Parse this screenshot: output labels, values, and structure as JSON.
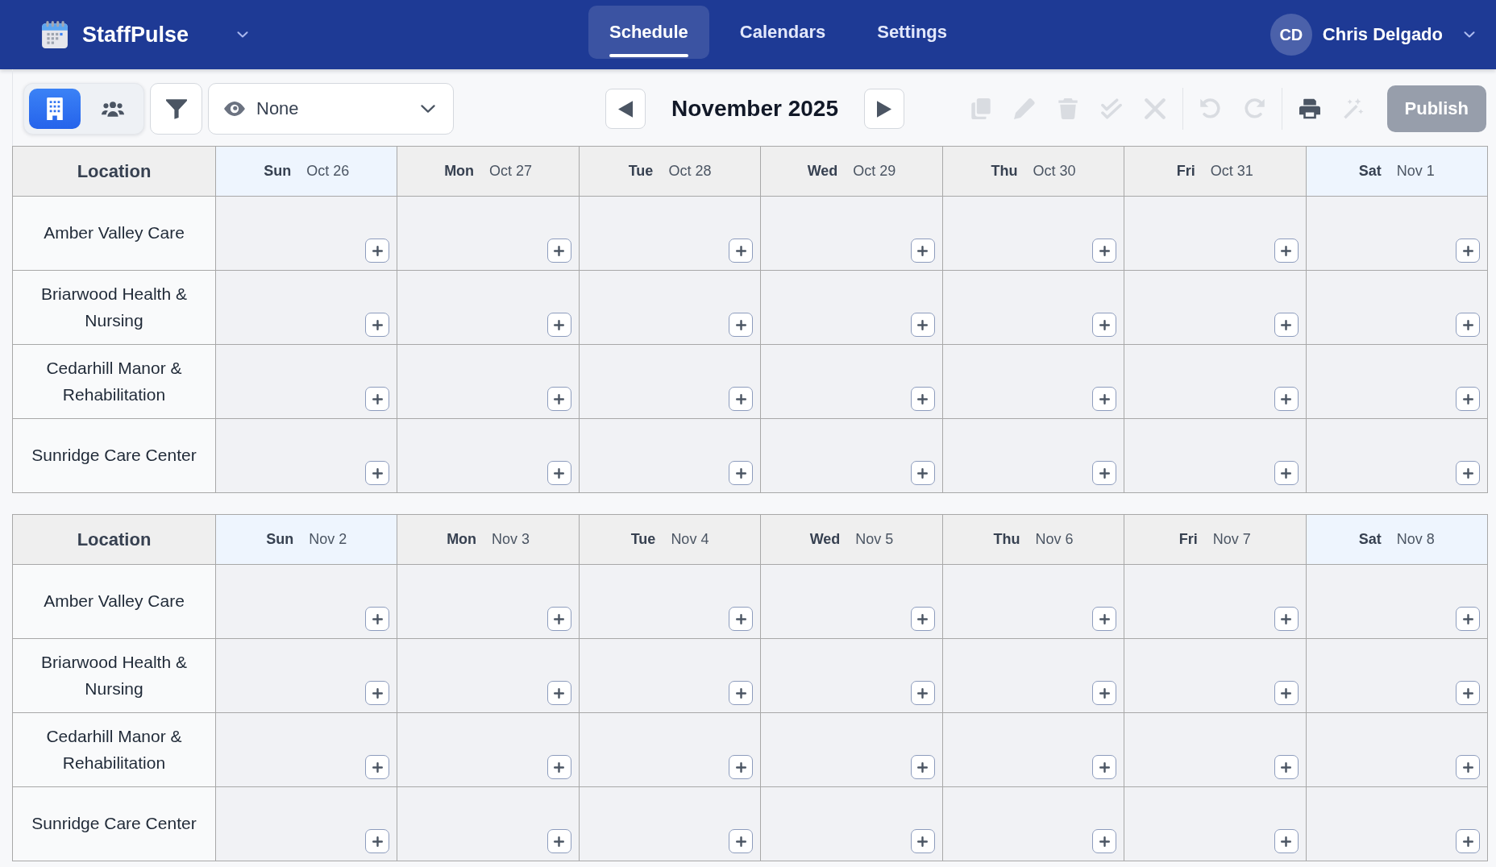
{
  "app": {
    "name": "StaffPulse"
  },
  "nav": {
    "tabs": [
      {
        "label": "Schedule",
        "selected": true
      },
      {
        "label": "Calendars",
        "selected": false
      },
      {
        "label": "Settings",
        "selected": false
      }
    ]
  },
  "user": {
    "initials": "CD",
    "name": "Chris Delgado"
  },
  "toolbar": {
    "view_toggle": [
      {
        "kind": "building",
        "selected": true
      },
      {
        "kind": "people",
        "selected": false
      }
    ],
    "visibility_select": {
      "value": "None"
    },
    "period": "November 2025",
    "action_groups": [
      {
        "actions": [
          {
            "kind": "copy",
            "disabled": true
          },
          {
            "kind": "edit",
            "disabled": true
          },
          {
            "kind": "delete",
            "disabled": true
          },
          {
            "kind": "approve",
            "disabled": true
          },
          {
            "kind": "reject",
            "disabled": true
          }
        ]
      },
      {
        "actions": [
          {
            "kind": "undo",
            "disabled": true
          },
          {
            "kind": "redo",
            "disabled": true
          }
        ]
      },
      {
        "actions": [
          {
            "kind": "print",
            "disabled": false
          },
          {
            "kind": "magic",
            "disabled": true
          }
        ]
      }
    ],
    "publish": {
      "label": "Publish",
      "disabled": true
    }
  },
  "weeks": [
    {
      "corner": "Location",
      "days": [
        {
          "weekday": "Sun",
          "date": "Oct 26",
          "highlighted": true
        },
        {
          "weekday": "Mon",
          "date": "Oct 27",
          "highlighted": false
        },
        {
          "weekday": "Tue",
          "date": "Oct 28",
          "highlighted": false
        },
        {
          "weekday": "Wed",
          "date": "Oct 29",
          "highlighted": false
        },
        {
          "weekday": "Thu",
          "date": "Oct 30",
          "highlighted": false
        },
        {
          "weekday": "Fri",
          "date": "Oct 31",
          "highlighted": false
        },
        {
          "weekday": "Sat",
          "date": "Nov 1",
          "highlighted": true
        }
      ],
      "rows": [
        {
          "location": "Amber Valley Care"
        },
        {
          "location": "Briarwood Health & Nursing"
        },
        {
          "location": "Cedarhill Manor & Rehabilitation"
        },
        {
          "location": "Sunridge Care Center"
        }
      ]
    },
    {
      "corner": "Location",
      "days": [
        {
          "weekday": "Sun",
          "date": "Nov 2",
          "highlighted": true
        },
        {
          "weekday": "Mon",
          "date": "Nov 3",
          "highlighted": false
        },
        {
          "weekday": "Tue",
          "date": "Nov 4",
          "highlighted": false
        },
        {
          "weekday": "Wed",
          "date": "Nov 5",
          "highlighted": false
        },
        {
          "weekday": "Thu",
          "date": "Nov 6",
          "highlighted": false
        },
        {
          "weekday": "Fri",
          "date": "Nov 7",
          "highlighted": false
        },
        {
          "weekday": "Sat",
          "date": "Nov 8",
          "highlighted": true
        }
      ],
      "rows": [
        {
          "location": "Amber Valley Care"
        },
        {
          "location": "Briarwood Health & Nursing"
        },
        {
          "location": "Cedarhill Manor & Rehabilitation"
        },
        {
          "location": "Sunridge Care Center"
        }
      ]
    }
  ]
}
